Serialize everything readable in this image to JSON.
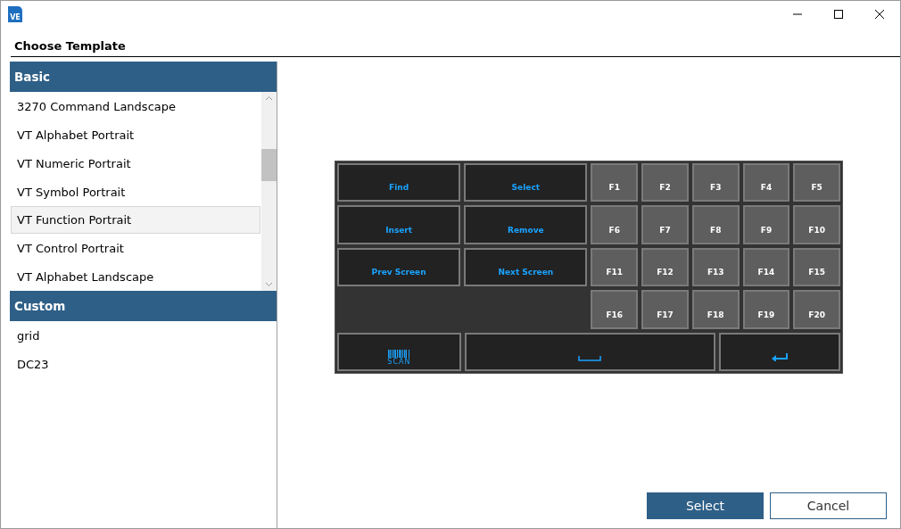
{
  "window": {
    "app_icon_text": "VE",
    "title": "Choose Template"
  },
  "groups": [
    {
      "header": "Basic",
      "scrollable": true,
      "items": [
        {
          "label": "3270 Command Landscape",
          "selected": false
        },
        {
          "label": "VT Alphabet Portrait",
          "selected": false
        },
        {
          "label": "VT Numeric Portrait",
          "selected": false
        },
        {
          "label": "VT Symbol Portrait",
          "selected": false
        },
        {
          "label": "VT Function Portrait",
          "selected": true
        },
        {
          "label": "VT Control Portrait",
          "selected": false
        },
        {
          "label": "VT Alphabet Landscape",
          "selected": false
        }
      ]
    },
    {
      "header": "Custom",
      "scrollable": false,
      "items": [
        {
          "label": "grid",
          "selected": false
        },
        {
          "label": "DC23",
          "selected": false
        }
      ]
    }
  ],
  "keyboard": {
    "rows": [
      [
        {
          "kind": "action",
          "label": "Find"
        },
        {
          "kind": "action",
          "label": "Select"
        },
        {
          "kind": "function",
          "label": "F1"
        },
        {
          "kind": "function",
          "label": "F2"
        },
        {
          "kind": "function",
          "label": "F3"
        },
        {
          "kind": "function",
          "label": "F4"
        },
        {
          "kind": "function",
          "label": "F5"
        }
      ],
      [
        {
          "kind": "action",
          "label": "Insert"
        },
        {
          "kind": "action",
          "label": "Remove"
        },
        {
          "kind": "function",
          "label": "F6"
        },
        {
          "kind": "function",
          "label": "F7"
        },
        {
          "kind": "function",
          "label": "F8"
        },
        {
          "kind": "function",
          "label": "F9"
        },
        {
          "kind": "function",
          "label": "F10"
        }
      ],
      [
        {
          "kind": "action",
          "label": "Prev Screen"
        },
        {
          "kind": "action",
          "label": "Next Screen"
        },
        {
          "kind": "function",
          "label": "F11"
        },
        {
          "kind": "function",
          "label": "F12"
        },
        {
          "kind": "function",
          "label": "F13"
        },
        {
          "kind": "function",
          "label": "F14"
        },
        {
          "kind": "function",
          "label": "F15"
        }
      ],
      [
        {
          "kind": "empty"
        },
        {
          "kind": "empty"
        },
        {
          "kind": "function",
          "label": "F16"
        },
        {
          "kind": "function",
          "label": "F17"
        },
        {
          "kind": "function",
          "label": "F18"
        },
        {
          "kind": "function",
          "label": "F19"
        },
        {
          "kind": "function",
          "label": "F20"
        }
      ]
    ],
    "bottom_row": [
      {
        "kind": "scan",
        "label": "SCAN"
      },
      {
        "kind": "space"
      },
      {
        "kind": "enter"
      }
    ]
  },
  "buttons": [
    {
      "label": "Select",
      "kind": "primary"
    },
    {
      "label": "Cancel",
      "kind": "secondary"
    }
  ]
}
